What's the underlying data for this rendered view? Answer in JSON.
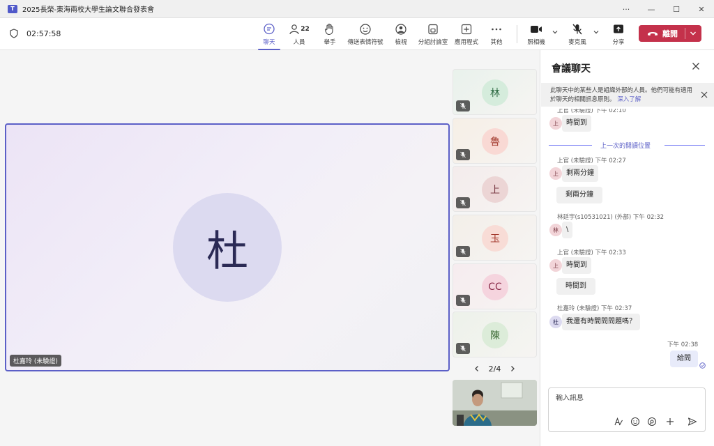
{
  "window": {
    "title": "2025長榮-東海兩校大學生論文聯合發表會",
    "controls": [
      "···",
      "—",
      "☐",
      "✕"
    ]
  },
  "toolbar": {
    "timer": "02:57:58",
    "chat_label": "聊天",
    "people_label": "人員",
    "people_count": "22",
    "raise_hand_label": "舉手",
    "reactions_label": "傳送表情符號",
    "view_label": "檢視",
    "rooms_label": "分組討論室",
    "apps_label": "應用程式",
    "more_label": "其他",
    "camera_label": "照相機",
    "mic_label": "麥克風",
    "share_label": "分享",
    "leave_label": "離開"
  },
  "stage": {
    "main": {
      "initial": "杜",
      "name": "杜嘉玲 (未驗證)"
    },
    "tiles": [
      {
        "initial": "林",
        "bg": "#e9f2ec",
        "av": "#d5ecdc",
        "fg": "#2f6b44"
      },
      {
        "initial": "魯",
        "bg": "#f6efe6",
        "av": "#f9d9d4",
        "fg": "#a33a2e"
      },
      {
        "initial": "上",
        "bg": "#f4ecec",
        "av": "#ecd5d5",
        "fg": "#7a3b45"
      },
      {
        "initial": "玉",
        "bg": "#f3efe9",
        "av": "#f8dcd6",
        "fg": "#a33a2e"
      },
      {
        "initial": "CC",
        "bg": "#f6ecef",
        "av": "#f5d4de",
        "fg": "#8d2f4d"
      },
      {
        "initial": "陳",
        "bg": "#edf2ea",
        "av": "#dcecd9",
        "fg": "#3d6b36"
      }
    ],
    "pager": "2/4"
  },
  "chat": {
    "title": "會議聊天",
    "notice": "此聊天中的某些人是組織外部的人員。他們可能有適用於聊天的相關訊息原則。",
    "notice_link": "深入了解",
    "unread_divider": "上一次的閱讀位置",
    "messages": [
      {
        "meta": "上官 (未驗證)  下午 02:10",
        "avatar": "上",
        "lines": [
          "時間到"
        ]
      },
      {
        "meta": "上官 (未驗證)  下午 02:27",
        "avatar": "上",
        "lines": [
          "剩兩分鐘",
          "剩兩分鐘"
        ]
      },
      {
        "meta": "林廷宇(s10531021) (外部)  下午 02:32",
        "avatar": "林",
        "lines": [
          "\\"
        ]
      },
      {
        "meta": "上官 (未驗證)  下午 02:33",
        "avatar": "上",
        "lines": [
          "時間到",
          "時間到"
        ]
      },
      {
        "meta": "杜嘉玲 (未驗證)  下午 02:37",
        "avatar": "杜",
        "lines": [
          "我還有時間問問題嗎？"
        ]
      }
    ],
    "my_meta": "下午 02:38",
    "my_message": "給問",
    "compose_placeholder": "輸入訊息"
  },
  "colors": {
    "accent": "#5b5fc7",
    "leave": "#c4314b"
  }
}
